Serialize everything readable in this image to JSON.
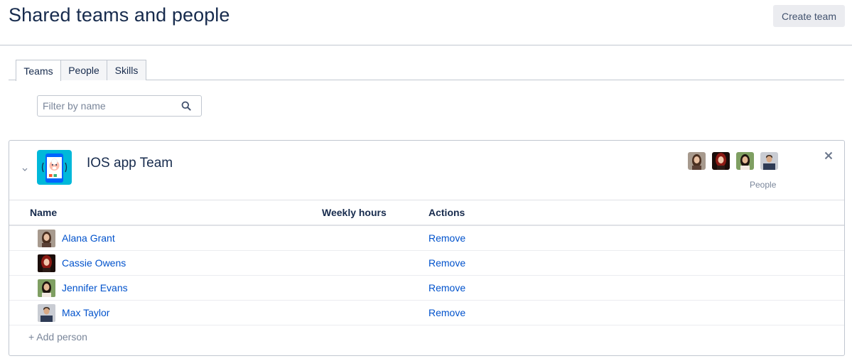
{
  "header": {
    "title": "Shared teams and people",
    "create_label": "Create team"
  },
  "tabs": [
    {
      "label": "Teams",
      "active": true
    },
    {
      "label": "People",
      "active": false
    },
    {
      "label": "Skills",
      "active": false
    }
  ],
  "filter": {
    "placeholder": "Filter by name",
    "value": ""
  },
  "team": {
    "name": "IOS app Team",
    "expanded": true,
    "people_caption": "People",
    "columns": {
      "name": "Name",
      "hours": "Weekly hours",
      "actions": "Actions"
    },
    "members": [
      {
        "name": "Alana Grant",
        "weekly_hours": "",
        "action": "Remove"
      },
      {
        "name": "Cassie Owens",
        "weekly_hours": "",
        "action": "Remove"
      },
      {
        "name": "Jennifer Evans",
        "weekly_hours": "",
        "action": "Remove"
      },
      {
        "name": "Max Taylor",
        "weekly_hours": "",
        "action": "Remove"
      }
    ],
    "add_person_label": "+ Add person"
  },
  "colors": {
    "title": "#172b4d",
    "link": "#0052cc",
    "muted": "#7a869a",
    "border": "#c1c7d0",
    "button_bg": "#ebecf0",
    "team_icon_bg": "#00b8d9"
  },
  "icons": {
    "search": "search-icon",
    "chevron": "chevron-down-icon",
    "close": "close-icon",
    "team": "team-app-icon"
  }
}
